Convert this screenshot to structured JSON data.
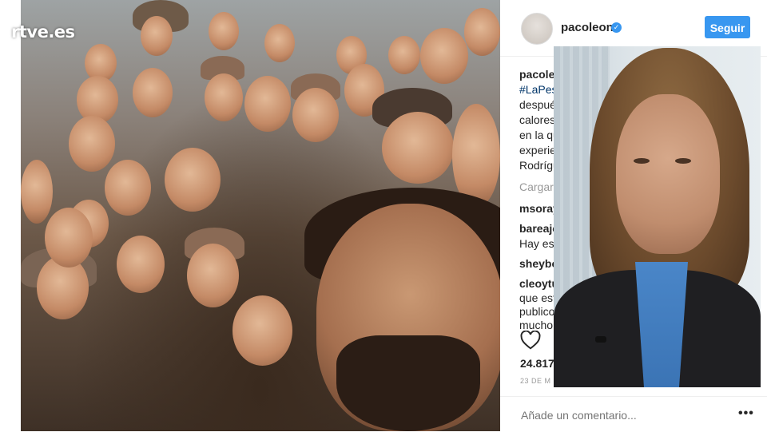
{
  "broadcaster": {
    "logo_text": "rtve.es"
  },
  "post": {
    "username": "pacoleon",
    "verified": true,
    "follow_label": "Seguir",
    "caption_lines": [
      {
        "user": "pacoleo",
        "text": ""
      },
      {
        "tag": "#LaPes",
        "text": ""
      },
      {
        "text": "despué"
      },
      {
        "text": "calores"
      },
      {
        "text": "en la qu"
      },
      {
        "text": "experie"
      },
      {
        "text": "Rodrígu"
      }
    ],
    "load_more": "Cargar",
    "comments": [
      {
        "user": "msoray",
        "text": ""
      },
      {
        "user": "bareajo",
        "text": "Hay es"
      },
      {
        "user": "sheybo",
        "text": ""
      },
      {
        "user": "cleoytu",
        "text": "que est\npublico\nmucho"
      }
    ],
    "likes": "24.817",
    "date": "23 DE M",
    "comment_placeholder": "Añade un comentario..."
  },
  "colors": {
    "accent": "#3897f0",
    "tag": "#003569"
  }
}
